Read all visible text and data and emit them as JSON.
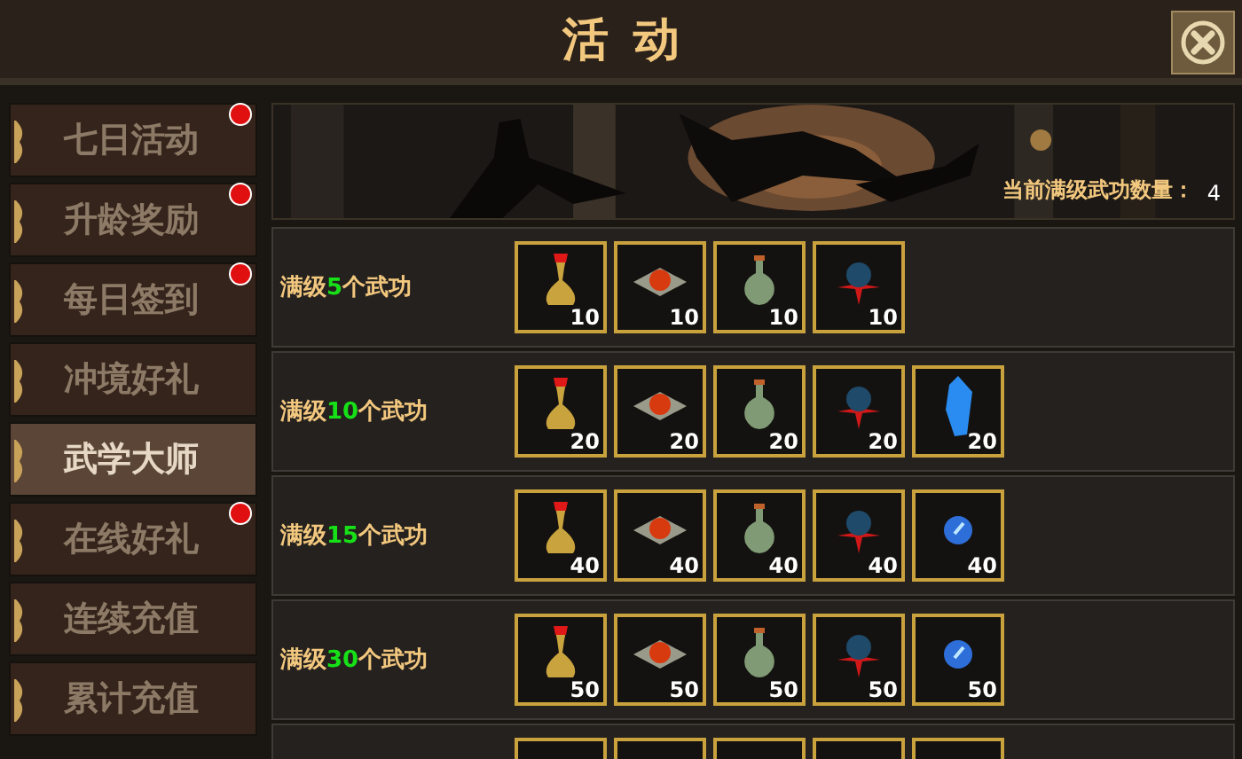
{
  "window": {
    "title": "活动"
  },
  "sidebar": {
    "items": [
      {
        "label": "七日活动",
        "selected": false,
        "badge": true
      },
      {
        "label": "升龄奖励",
        "selected": false,
        "badge": true
      },
      {
        "label": "每日签到",
        "selected": false,
        "badge": true
      },
      {
        "label": "冲境好礼",
        "selected": false,
        "badge": false
      },
      {
        "label": "武学大师",
        "selected": true,
        "badge": false
      },
      {
        "label": "在线好礼",
        "selected": false,
        "badge": true
      },
      {
        "label": "连续充值",
        "selected": false,
        "badge": false
      },
      {
        "label": "累计充值",
        "selected": false,
        "badge": false
      }
    ]
  },
  "banner": {
    "kind": "picture",
    "label": "当前满级武功数量：",
    "value": "4"
  },
  "rows": [
    {
      "prefix": "满级",
      "count": "5",
      "suffix": "个武功",
      "items": [
        {
          "kind": "gourd",
          "quantity": "10"
        },
        {
          "kind": "orb-plate",
          "quantity": "10"
        },
        {
          "kind": "flask",
          "quantity": "10"
        },
        {
          "kind": "dark-orb",
          "quantity": "10"
        }
      ]
    },
    {
      "prefix": "满级",
      "count": "10",
      "suffix": "个武功",
      "items": [
        {
          "kind": "gourd",
          "quantity": "20"
        },
        {
          "kind": "orb-plate",
          "quantity": "20"
        },
        {
          "kind": "flask",
          "quantity": "20"
        },
        {
          "kind": "dark-orb",
          "quantity": "20"
        },
        {
          "kind": "crystal",
          "quantity": "20"
        }
      ]
    },
    {
      "prefix": "满级",
      "count": "15",
      "suffix": "个武功",
      "items": [
        {
          "kind": "gourd",
          "quantity": "40"
        },
        {
          "kind": "orb-plate",
          "quantity": "40"
        },
        {
          "kind": "flask",
          "quantity": "40"
        },
        {
          "kind": "dark-orb",
          "quantity": "40"
        },
        {
          "kind": "pearl",
          "quantity": "40"
        }
      ]
    },
    {
      "prefix": "满级",
      "count": "30",
      "suffix": "个武功",
      "items": [
        {
          "kind": "gourd",
          "quantity": "50"
        },
        {
          "kind": "orb-plate",
          "quantity": "50"
        },
        {
          "kind": "flask",
          "quantity": "50"
        },
        {
          "kind": "dark-orb",
          "quantity": "50"
        },
        {
          "kind": "pearl",
          "quantity": "50"
        }
      ]
    },
    {
      "items": [
        {
          "kind": "slot"
        },
        {
          "kind": "slot"
        },
        {
          "kind": "slot"
        },
        {
          "kind": "slot"
        },
        {
          "kind": "slot"
        }
      ]
    }
  ]
}
